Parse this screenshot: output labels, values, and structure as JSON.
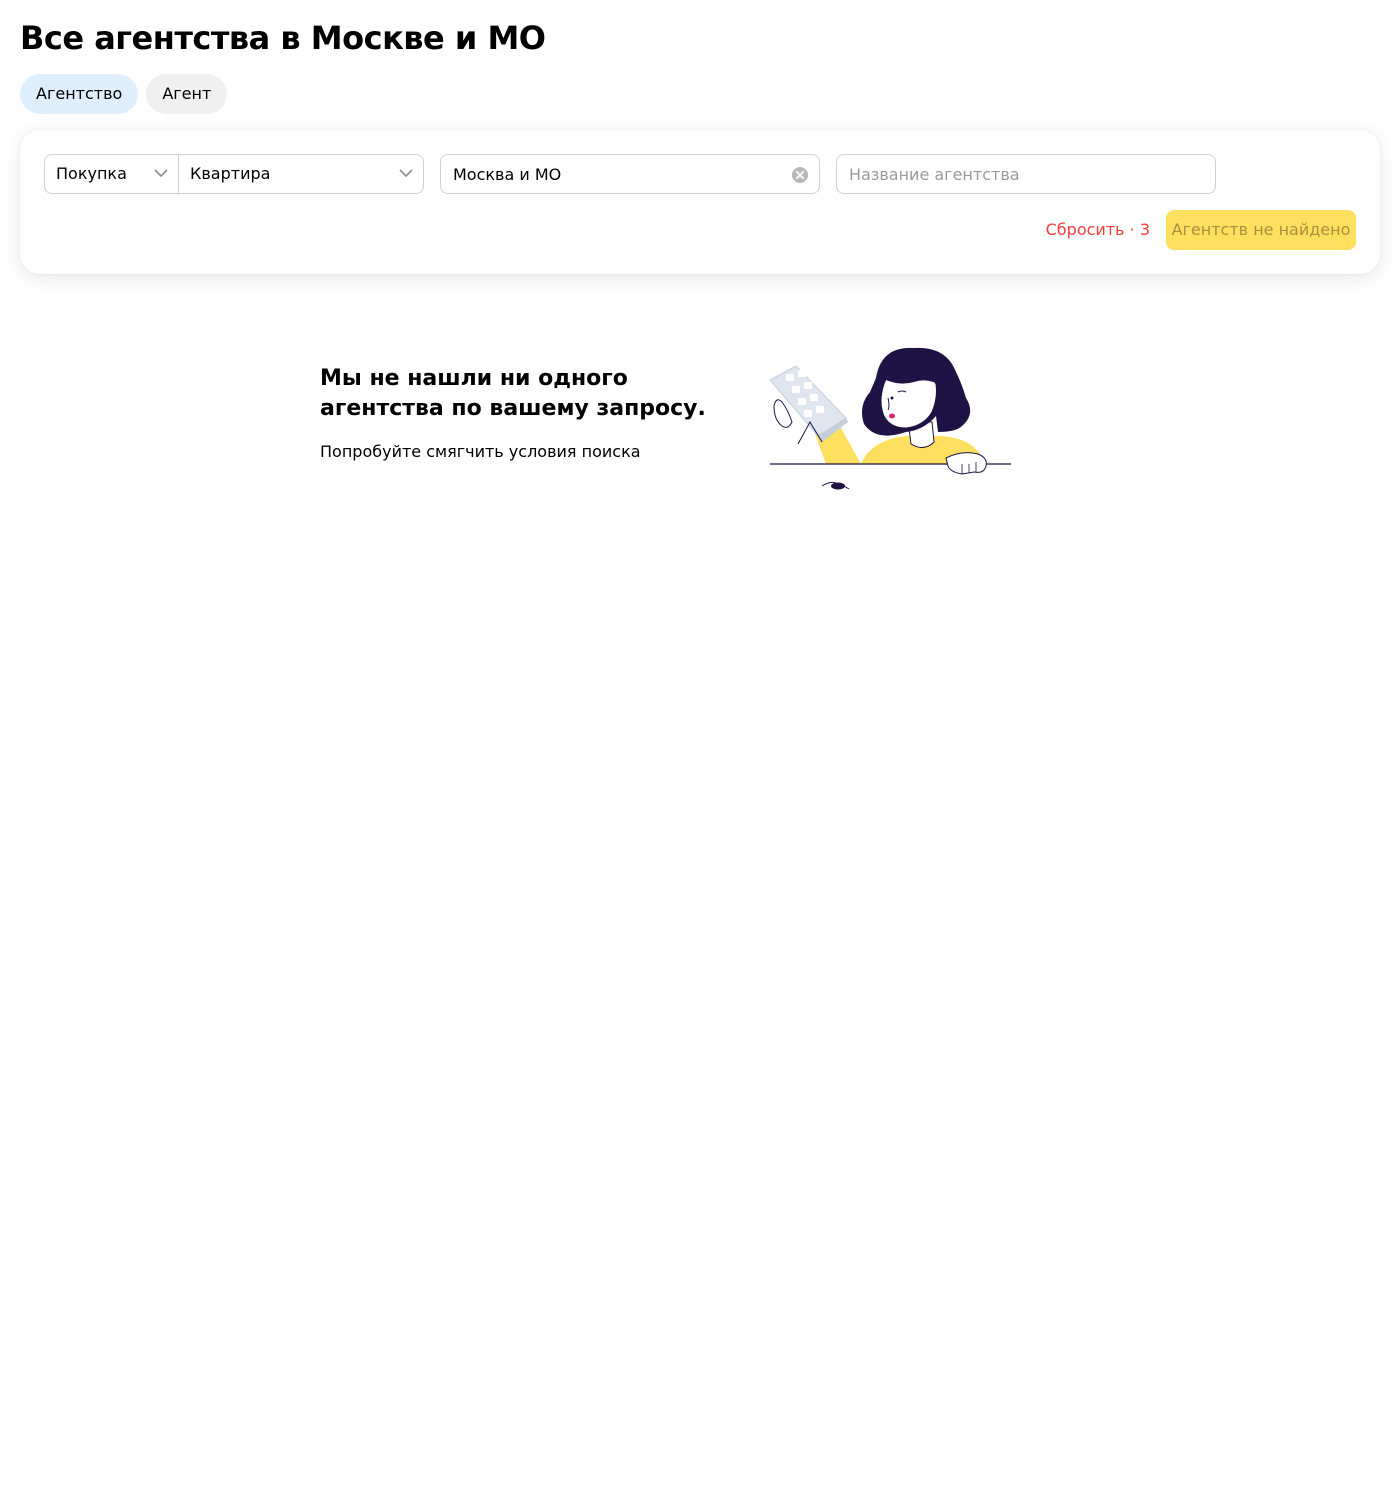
{
  "page": {
    "title": "Все агентства в Москве и МО"
  },
  "tabs": [
    {
      "label": "Агентство",
      "active": true
    },
    {
      "label": "Агент",
      "active": false
    }
  ],
  "filters": {
    "deal_type": {
      "value": "Покупка",
      "icon": "chevron-down-icon"
    },
    "property_type": {
      "value": "Квартира",
      "icon": "chevron-down-icon"
    },
    "region": {
      "value": "Москва и МО",
      "clear_icon": "clear-circle-icon"
    },
    "agency_name": {
      "value": "",
      "placeholder": "Название агентства"
    },
    "reset_label": "Сбросить · 3",
    "submit_label": "Агентств не найдено"
  },
  "empty_state": {
    "title": "Мы не нашли ни одного агентства по вашему запросу.",
    "text": "Попробуйте смягчить условия поиска",
    "illustration": "woman-holding-building-illustration"
  },
  "colors": {
    "active_tab": "#dfeefc",
    "inactive_tab": "#f0f0f0",
    "reset_text": "#f0403a",
    "submit_bg": "#ffdf5e",
    "submit_text": "#a88f3d",
    "illustration_hair": "#1e1344",
    "illustration_shirt": "#ffdf5e"
  }
}
